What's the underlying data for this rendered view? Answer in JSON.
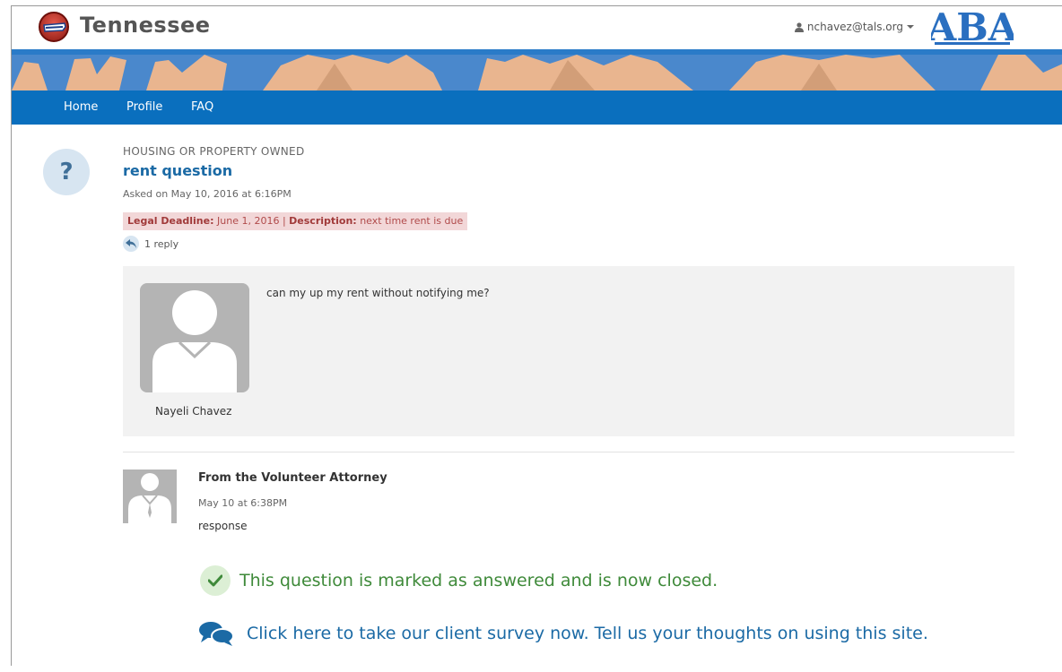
{
  "header": {
    "site_title": "Tennessee",
    "user_email": "nchavez@tals.org",
    "aba_logo_text": "ABA"
  },
  "nav": {
    "items": [
      {
        "label": "Home"
      },
      {
        "label": "Profile"
      },
      {
        "label": "FAQ"
      }
    ]
  },
  "question": {
    "category": "HOUSING OR PROPERTY OWNED",
    "title": "rent question",
    "asked": "Asked on May 10, 2016 at 6:16PM",
    "deadline_label": "Legal Deadline:",
    "deadline_value": "June 1, 2016",
    "separator": "|",
    "description_label": "Description:",
    "description_value": "next time rent is due",
    "reply_count": "1 reply",
    "body": "can my up my rent without notifying me?",
    "author": "Nayeli Chavez"
  },
  "response": {
    "from": "From the Volunteer Attorney",
    "time": "May 10 at 6:38PM",
    "text": "response"
  },
  "status": {
    "closed_message": "This question is marked as answered and is now closed.",
    "survey_link": "Click here to take our client survey now. Tell us your thoughts on using this site."
  },
  "colors": {
    "nav_blue": "#0a6fbe",
    "link_blue": "#1b6aa5",
    "success_green": "#3f8a3a",
    "deadline_bg": "#f2d7d8"
  }
}
